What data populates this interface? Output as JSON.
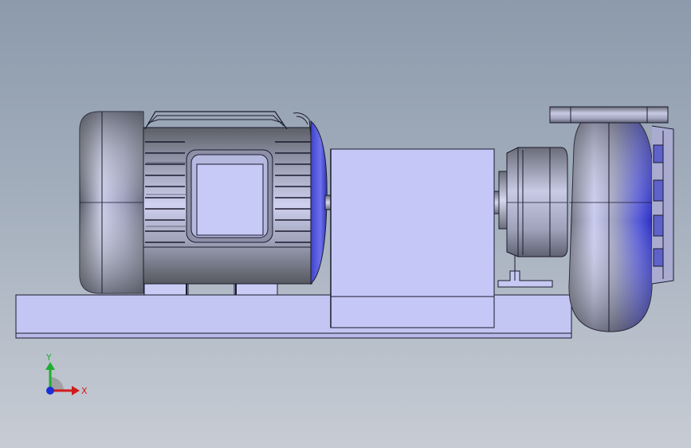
{
  "viewport": {
    "background_top": "#8c9aab",
    "background_bottom": "#c7ccd4",
    "model_color": "#c4c8f5",
    "model_shade": "#7f84d8",
    "edge_color": "#1a1a2e"
  },
  "triad": {
    "x_label": "X",
    "y_label": "Y",
    "x_color": "#d11b1b",
    "y_color": "#1fae2f",
    "z_color": "#1b2fd6"
  }
}
